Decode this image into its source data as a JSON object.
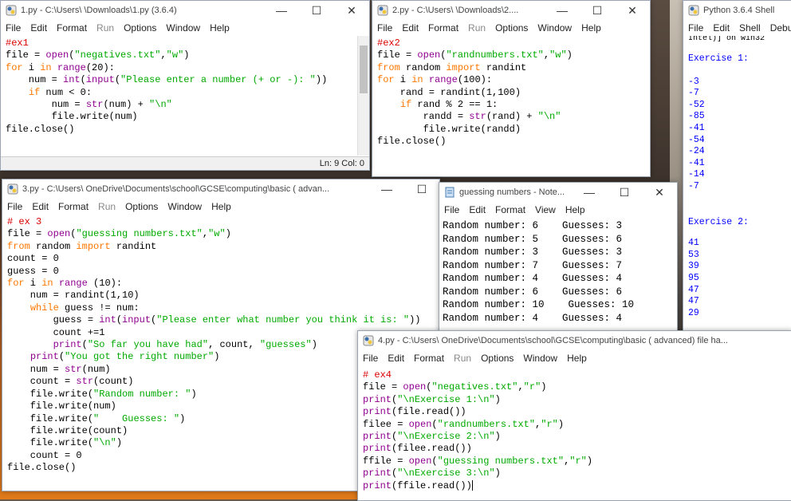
{
  "w1": {
    "title": "1.py - C:\\Users\\        \\Downloads\\1.py (3.6.4)",
    "menu": [
      "File",
      "Edit",
      "Format",
      "Run",
      "Options",
      "Window",
      "Help"
    ],
    "status": "Ln: 9   Col: 0",
    "lines": [
      [
        [
          "cm",
          "#ex1"
        ]
      ],
      [
        [
          "",
          "file = "
        ],
        [
          "bi",
          "open"
        ],
        [
          "",
          "("
        ],
        [
          "st",
          "\"negatives.txt\""
        ],
        [
          "",
          ","
        ],
        [
          "st",
          "\"w\""
        ],
        [
          "",
          ")"
        ]
      ],
      [
        [
          "kw",
          "for"
        ],
        [
          "",
          " i "
        ],
        [
          "kw",
          "in"
        ],
        [
          "",
          " "
        ],
        [
          "bi",
          "range"
        ],
        [
          "",
          "(20):"
        ]
      ],
      [
        [
          "",
          "    num = "
        ],
        [
          "bi",
          "int"
        ],
        [
          "",
          "("
        ],
        [
          "bi",
          "input"
        ],
        [
          "",
          "("
        ],
        [
          "st",
          "\"Please enter a number (+ or -): \""
        ],
        [
          "",
          "))"
        ]
      ],
      [
        [
          "",
          "    "
        ],
        [
          "kw",
          "if"
        ],
        [
          "",
          " num < 0:"
        ]
      ],
      [
        [
          "",
          "        num = "
        ],
        [
          "bi",
          "str"
        ],
        [
          "",
          "(num) + "
        ],
        [
          "st",
          "\"\\n\""
        ]
      ],
      [
        [
          "",
          "        file.write(num)"
        ]
      ],
      [
        [
          "",
          "file.close()"
        ]
      ]
    ]
  },
  "w2": {
    "title": "2.py - C:\\Users\\        \\Downloads\\2....",
    "menu": [
      "File",
      "Edit",
      "Format",
      "Run",
      "Options",
      "Window",
      "Help"
    ],
    "lines": [
      [
        [
          "cm",
          "#ex2"
        ]
      ],
      [
        [
          "",
          "file = "
        ],
        [
          "bi",
          "open"
        ],
        [
          "",
          "("
        ],
        [
          "st",
          "\"randnumbers.txt\""
        ],
        [
          "",
          ","
        ],
        [
          "st",
          "\"w\""
        ],
        [
          "",
          ")"
        ]
      ],
      [
        [
          "kw",
          "from"
        ],
        [
          "",
          " random "
        ],
        [
          "kw",
          "import"
        ],
        [
          "",
          " randint"
        ]
      ],
      [
        [
          "kw",
          "for"
        ],
        [
          "",
          " i "
        ],
        [
          "kw",
          "in"
        ],
        [
          "",
          " "
        ],
        [
          "bi",
          "range"
        ],
        [
          "",
          "(100):"
        ]
      ],
      [
        [
          "",
          "    rand = randint(1,100)"
        ]
      ],
      [
        [
          "",
          "    "
        ],
        [
          "kw",
          "if"
        ],
        [
          "",
          " rand % 2 == 1:"
        ]
      ],
      [
        [
          "",
          "        randd = "
        ],
        [
          "bi",
          "str"
        ],
        [
          "",
          "(rand) + "
        ],
        [
          "st",
          "\"\\n\""
        ]
      ],
      [
        [
          "",
          "        file.write(randd)"
        ]
      ],
      [
        [
          "",
          "file.close()"
        ]
      ]
    ]
  },
  "w3": {
    "title": "3.py - C:\\Users\\        OneDrive\\Documents\\school\\GCSE\\computing\\basic ( advan...",
    "menu": [
      "File",
      "Edit",
      "Format",
      "Run",
      "Options",
      "Window",
      "Help"
    ],
    "lines": [
      [
        [
          "cm",
          "# ex 3"
        ]
      ],
      [
        [
          "",
          "file = "
        ],
        [
          "bi",
          "open"
        ],
        [
          "",
          "("
        ],
        [
          "st",
          "\"guessing numbers.txt\""
        ],
        [
          "",
          ","
        ],
        [
          "st",
          "\"w\""
        ],
        [
          "",
          ")"
        ]
      ],
      [
        [
          "kw",
          "from"
        ],
        [
          "",
          " random "
        ],
        [
          "kw",
          "import"
        ],
        [
          "",
          " randint"
        ]
      ],
      [
        [
          "",
          "count = 0"
        ]
      ],
      [
        [
          "",
          "guess = 0"
        ]
      ],
      [
        [
          "kw",
          "for"
        ],
        [
          "",
          " i "
        ],
        [
          "kw",
          "in"
        ],
        [
          "",
          " "
        ],
        [
          "bi",
          "range"
        ],
        [
          "",
          " (10):"
        ]
      ],
      [
        [
          "",
          "    num = randint(1,10)"
        ]
      ],
      [
        [
          "",
          "    "
        ],
        [
          "kw",
          "while"
        ],
        [
          "",
          " guess != num:"
        ]
      ],
      [
        [
          "",
          "        guess = "
        ],
        [
          "bi",
          "int"
        ],
        [
          "",
          "("
        ],
        [
          "bi",
          "input"
        ],
        [
          "",
          "("
        ],
        [
          "st",
          "\"Please enter what number you think it is: \""
        ],
        [
          "",
          "))"
        ]
      ],
      [
        [
          "",
          "        count +=1"
        ]
      ],
      [
        [
          "",
          "        "
        ],
        [
          "bi",
          "print"
        ],
        [
          "",
          "("
        ],
        [
          "st",
          "\"So far you have had\""
        ],
        [
          "",
          ", count, "
        ],
        [
          "st",
          "\"guesses\""
        ],
        [
          "",
          ")"
        ]
      ],
      [
        [
          "",
          "    "
        ],
        [
          "bi",
          "print"
        ],
        [
          "",
          "("
        ],
        [
          "st",
          "\"You got the right number\""
        ],
        [
          "",
          ")"
        ]
      ],
      [
        [
          "",
          "    num = "
        ],
        [
          "bi",
          "str"
        ],
        [
          "",
          "(num)"
        ]
      ],
      [
        [
          "",
          "    count = "
        ],
        [
          "bi",
          "str"
        ],
        [
          "",
          "(count)"
        ]
      ],
      [
        [
          "",
          "    file.write("
        ],
        [
          "st",
          "\"Random number: \""
        ],
        [
          "",
          ")"
        ]
      ],
      [
        [
          "",
          "    file.write(num)"
        ]
      ],
      [
        [
          "",
          "    file.write("
        ],
        [
          "st",
          "\"    Guesses: \""
        ],
        [
          "",
          ")"
        ]
      ],
      [
        [
          "",
          "    file.write(count)"
        ]
      ],
      [
        [
          "",
          "    file.write("
        ],
        [
          "st",
          "\"\\n\""
        ],
        [
          "",
          ")"
        ]
      ],
      [
        [
          "",
          "    count = 0"
        ]
      ],
      [
        [
          "",
          "file.close()"
        ]
      ]
    ]
  },
  "np": {
    "title": "guessing numbers - Note...",
    "menu": [
      "File",
      "Edit",
      "Format",
      "View",
      "Help"
    ],
    "lines": [
      "Random number: 6    Guesses: 3",
      "Random number: 5    Guesses: 6",
      "Random number: 3    Guesses: 3",
      "Random number: 7    Guesses: 7",
      "Random number: 4    Guesses: 4",
      "Random number: 6    Guesses: 6",
      "Random number: 10    Guesses: 10",
      "Random number: 4    Guesses: 4"
    ]
  },
  "shell": {
    "title": "Python 3.6.4 Shell",
    "menu": [
      "File",
      "Edit",
      "Shell",
      "Debu"
    ],
    "top": "Intel)] on win32",
    "ex1": "Exercise 1:",
    "ex1_vals": [
      "-3",
      "-7",
      "-52",
      "-85",
      "-41",
      "-54",
      "-24",
      "-41",
      "-14",
      "-7"
    ],
    "ex2": "Exercise 2:",
    "ex2_vals": [
      "41",
      "53",
      "39",
      "95",
      "47",
      "47",
      "29"
    ]
  },
  "w4": {
    "title": "4.py - C:\\Users\\        OneDrive\\Documents\\school\\GCSE\\computing\\basic ( advanced) file ha...",
    "menu": [
      "File",
      "Edit",
      "Format",
      "Run",
      "Options",
      "Window",
      "Help"
    ],
    "lines": [
      [
        [
          "cm",
          "# ex4"
        ]
      ],
      [
        [
          "",
          "file = "
        ],
        [
          "bi",
          "open"
        ],
        [
          "",
          "("
        ],
        [
          "st",
          "\"negatives.txt\""
        ],
        [
          "",
          ","
        ],
        [
          "st",
          "\"r\""
        ],
        [
          "",
          ")"
        ]
      ],
      [
        [
          "bi",
          "print"
        ],
        [
          "",
          "("
        ],
        [
          "st",
          "\"\\nExercise 1:\\n\""
        ],
        [
          "",
          ")"
        ]
      ],
      [
        [
          "bi",
          "print"
        ],
        [
          "",
          "(file.read())"
        ]
      ],
      [
        [
          "",
          "filee = "
        ],
        [
          "bi",
          "open"
        ],
        [
          "",
          "("
        ],
        [
          "st",
          "\"randnumbers.txt\""
        ],
        [
          "",
          ","
        ],
        [
          "st",
          "\"r\""
        ],
        [
          "",
          ")"
        ]
      ],
      [
        [
          "bi",
          "print"
        ],
        [
          "",
          "("
        ],
        [
          "st",
          "\"\\nExercise 2:\\n\""
        ],
        [
          "",
          ")"
        ]
      ],
      [
        [
          "bi",
          "print"
        ],
        [
          "",
          "(filee.read())"
        ]
      ],
      [
        [
          "",
          "ffile = "
        ],
        [
          "bi",
          "open"
        ],
        [
          "",
          "("
        ],
        [
          "st",
          "\"guessing numbers.txt\""
        ],
        [
          "",
          ","
        ],
        [
          "st",
          "\"r\""
        ],
        [
          "",
          ")"
        ]
      ],
      [
        [
          "bi",
          "print"
        ],
        [
          "",
          "("
        ],
        [
          "st",
          "\"\\nExercise 3:\\n\""
        ],
        [
          "",
          ")"
        ]
      ],
      [
        [
          "bi",
          "print"
        ],
        [
          "",
          "(ffile.read())"
        ]
      ]
    ]
  },
  "colors": {
    "keyword": "#ff7700",
    "builtin": "#900090",
    "string": "#00aa00",
    "comment": "#dd0000",
    "shell_output": "#0000ff"
  },
  "icons": {
    "idle": "python-idle-icon",
    "notepad": "notepad-icon",
    "minimize": "minimize-icon",
    "maximize": "maximize-icon",
    "close": "close-icon"
  }
}
